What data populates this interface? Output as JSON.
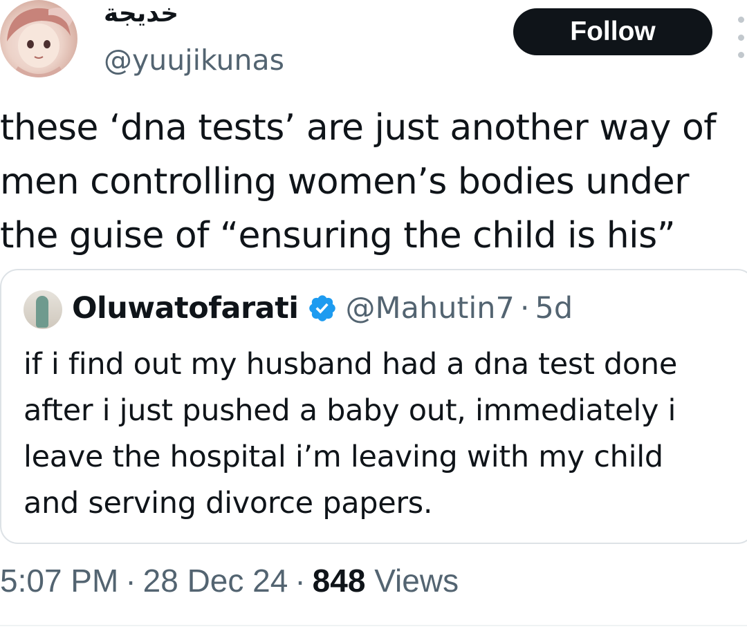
{
  "tweet": {
    "author": {
      "display_name": "خديجة",
      "handle": "@yuujikunas"
    },
    "follow_label": "Follow",
    "text_lines": [
      "these ‘dna tests’ are just another way of",
      "men controlling women’s bodies under",
      "the guise of “ensuring the child is his”"
    ],
    "timestamp": "5:07 PM",
    "date": "28 Dec 24",
    "separator": "·",
    "views_count": "848",
    "views_label": "Views"
  },
  "quote": {
    "display_name": "Oluwatofarati",
    "verified": true,
    "handle": "@Mahutin7",
    "separator": "·",
    "age": "5d",
    "text_lines": [
      "if i find out my husband had a dna test done",
      "after i just pushed a baby out, immediately i",
      "leave the hospital i’m leaving with my child",
      "and serving divorce papers."
    ]
  },
  "colors": {
    "text_primary": "#0f1419",
    "text_secondary": "#536471",
    "follow_bg": "#0f1419",
    "verified_blue": "#1d9bf0",
    "border": "#dde2e6"
  },
  "icons": {
    "more": "more-vertical-icon",
    "verified": "verified-badge-icon"
  }
}
